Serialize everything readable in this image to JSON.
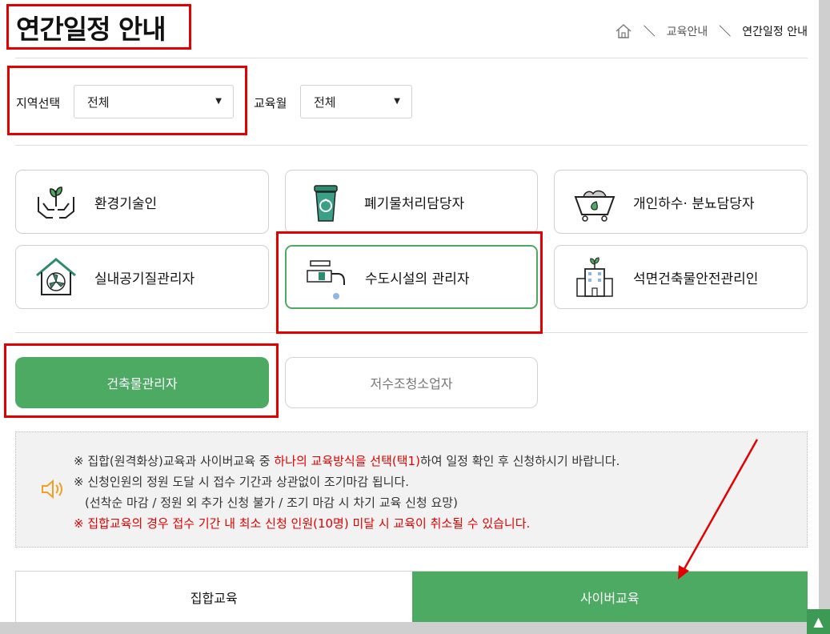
{
  "header": {
    "title": "연간일정 안내",
    "breadcrumb": {
      "home_icon": "home-icon",
      "level1": "교육안내",
      "separator": "＼",
      "current": "연간일정 안내"
    }
  },
  "filters": {
    "region": {
      "label": "지역선택",
      "value": "전체"
    },
    "month": {
      "label": "교육월",
      "value": "전체"
    }
  },
  "categories": [
    {
      "label": "환경기술인",
      "icon": "plant-hands-icon",
      "active": false
    },
    {
      "label": "폐기물처리담당자",
      "icon": "recycle-bin-icon",
      "active": false
    },
    {
      "label": "개인하수· 분뇨담당자",
      "icon": "cart-leaf-icon",
      "active": false
    },
    {
      "label": "실내공기질관리자",
      "icon": "house-fan-icon",
      "active": true
    },
    {
      "label": "수도시설의 관리자",
      "icon": "faucet-icon",
      "active": true
    },
    {
      "label": "석면건축물안전관리인",
      "icon": "building-plant-icon",
      "active": false
    }
  ],
  "subtypes": [
    {
      "label": "건축물관리자",
      "selected": true
    },
    {
      "label": "저수조청소업자",
      "selected": false
    }
  ],
  "notice": {
    "icon": "speaker-icon",
    "line1_a": "※ 집합(원격화상)교육과 사이버교육 중 ",
    "line1_red": "하나의 교육방식을 선택(택1)",
    "line1_b": "하여 일정 확인 후 신청하시기 바랍니다.",
    "line2": "※ 신청인원의 정원 도달 시 접수 기간과 상관없이 조기마감 됩니다.",
    "line3": "(선착순 마감 / 정원 외 추가 신청 불가 / 조기 마감 시 차기 교육 신청 요망)",
    "line4": "※ 집합교육의 경우 접수 기간 내 최소 신청 인원(10명) 미달 시 교육이 취소될 수 있습니다."
  },
  "tabs": [
    {
      "label": "집합교육",
      "active": false
    },
    {
      "label": "사이버교육",
      "active": true
    }
  ],
  "scroll_top": {
    "icon": "up-arrow-icon",
    "label": "▲"
  },
  "colors": {
    "accent": "#4daa63",
    "highlight": "#e30000",
    "notice_red": "#e00000"
  }
}
